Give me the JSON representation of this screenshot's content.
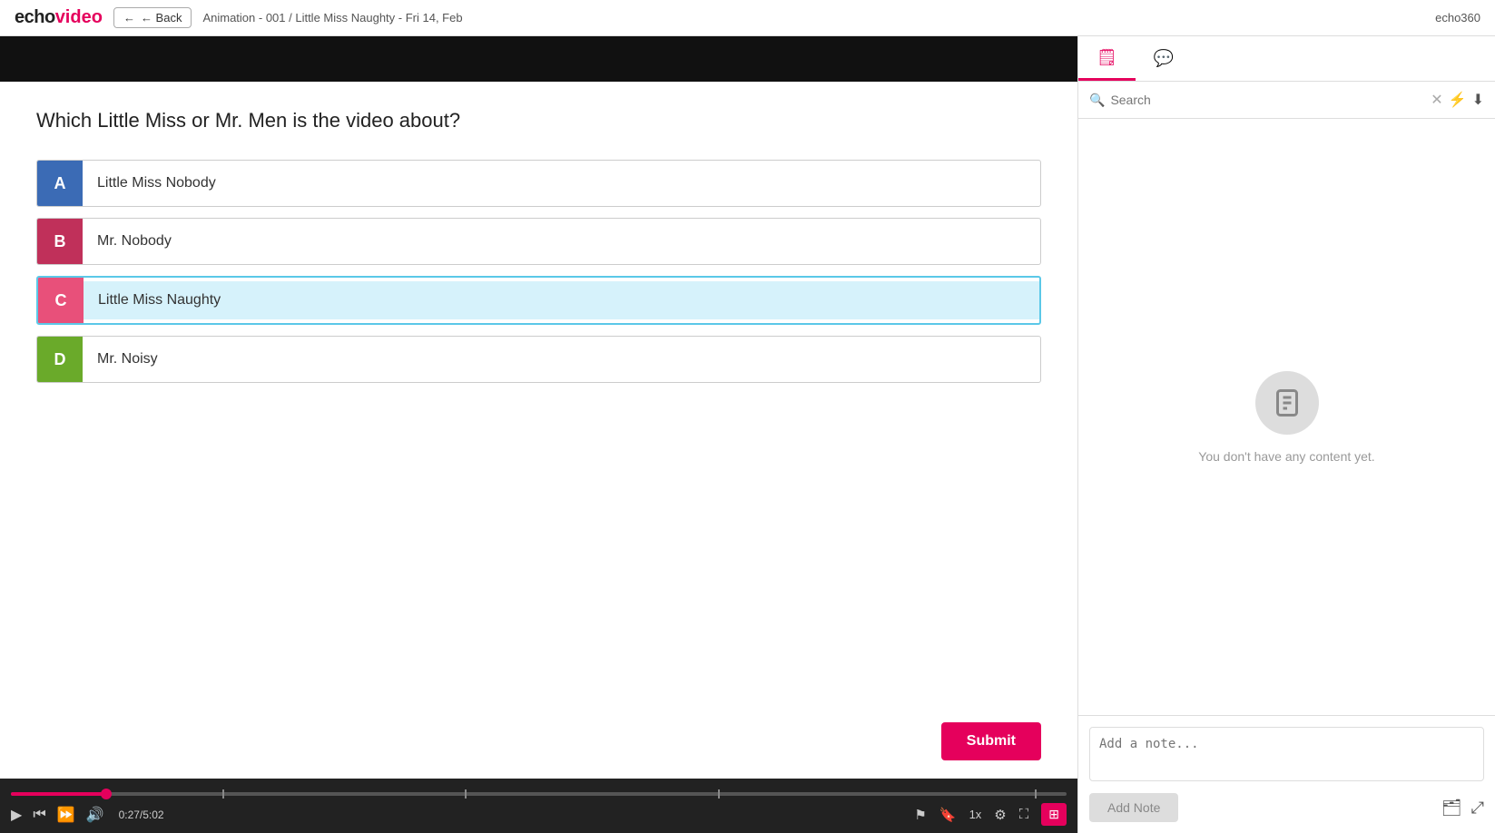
{
  "topbar": {
    "logo_echo": "echo",
    "logo_video": "video",
    "back_label": "← Back",
    "breadcrumb": "Animation - 001 / Little Miss Naughty - Fri 14, Feb",
    "echo360": "echo360"
  },
  "quiz": {
    "question": "Which Little Miss or Mr. Men is the video about?",
    "options": [
      {
        "id": "A",
        "text": "Little Miss Nobody",
        "color_class": "label-blue",
        "selected": false
      },
      {
        "id": "B",
        "text": "Mr. Nobody",
        "color_class": "label-pink",
        "selected": false
      },
      {
        "id": "C",
        "text": "Little Miss Naughty",
        "color_class": "label-lightpink",
        "selected": true
      },
      {
        "id": "D",
        "text": "Mr. Noisy",
        "color_class": "label-green",
        "selected": false
      }
    ],
    "submit_label": "Submit"
  },
  "video_controls": {
    "time_display": "0:27/5:02",
    "speed": "1x"
  },
  "sidebar": {
    "tabs": [
      {
        "label": "notes-tab",
        "icon": "🗒",
        "active": true
      },
      {
        "label": "chat-tab",
        "icon": "💬",
        "active": false
      }
    ],
    "search_placeholder": "Search",
    "empty_message": "You don't have any content yet.",
    "note_placeholder": "Add a note...",
    "add_note_label": "Add Note"
  }
}
